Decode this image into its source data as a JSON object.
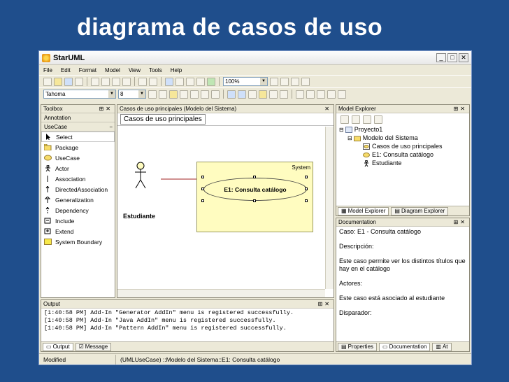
{
  "slide": {
    "title": "diagrama de casos de uso"
  },
  "app": {
    "title": "StarUML",
    "menu": [
      "File",
      "Edit",
      "Format",
      "Model",
      "View",
      "Tools",
      "Help"
    ],
    "zoom": "100%",
    "font": "Tahoma",
    "font_size": "8"
  },
  "toolbox": {
    "header": "Toolbox",
    "group_annotation": "Annotation",
    "group_usecase": "UseCase",
    "items": [
      {
        "label": "Select",
        "icon": "arrow-icon"
      },
      {
        "label": "Package",
        "icon": "package-icon"
      },
      {
        "label": "UseCase",
        "icon": "usecase-icon"
      },
      {
        "label": "Actor",
        "icon": "actor-icon"
      },
      {
        "label": "Association",
        "icon": "association-icon"
      },
      {
        "label": "DirectedAssociation",
        "icon": "directed-association-icon"
      },
      {
        "label": "Generalization",
        "icon": "generalization-icon"
      },
      {
        "label": "Dependency",
        "icon": "dependency-icon"
      },
      {
        "label": "Include",
        "icon": "include-icon"
      },
      {
        "label": "Extend",
        "icon": "extend-icon"
      },
      {
        "label": "System Boundary",
        "icon": "system-boundary-icon"
      }
    ]
  },
  "diagram": {
    "header": "Casos de uso principales (Modelo del Sistema)",
    "tab": "Casos de uso principales",
    "system_label": "System",
    "usecase": "E1: Consulta catálogo",
    "actor": "Estudiante"
  },
  "model_explorer": {
    "header": "Model Explorer",
    "tree": [
      {
        "label": "Proyecto1",
        "icon": "project-icon"
      },
      {
        "label": "Modelo del Sistema",
        "icon": "model-icon"
      },
      {
        "label": "Casos de uso principales",
        "icon": "diagram-icon"
      },
      {
        "label": "E1: Consulta catálogo",
        "icon": "usecase-icon"
      },
      {
        "label": "Estudiante",
        "icon": "actor-icon"
      }
    ],
    "tabs": [
      "Model Explorer",
      "Diagram Explorer"
    ]
  },
  "documentation": {
    "header": "Documentation",
    "lines": [
      "Caso: E1 - Consulta catálogo",
      "Descripción:",
      "Este caso permite ver los distintos títulos que hay en el catálogo",
      "Actores:",
      "Este caso está asociado al estudiante",
      "Disparador:"
    ],
    "tabs": [
      "Properties",
      "Documentation",
      "At"
    ]
  },
  "output": {
    "header": "Output",
    "lines": [
      "[1:40:58 PM]  Add-In \"Generator AddIn\" menu is registered successfully.",
      "[1:40:58 PM]  Add-In \"Java AddIn\" menu is registered successfully.",
      "[1:40:58 PM]  Add-In \"Pattern AddIn\" menu is registered successfully."
    ],
    "tabs": [
      "Output",
      "Message"
    ]
  },
  "status": {
    "state": "Modified",
    "selection": "(UMLUseCase) ::Modelo del Sistema::E1: Consulta catálogo"
  },
  "colors": {
    "slide_bg": "#1f4e8c",
    "system_fill": "#fffcc0"
  }
}
